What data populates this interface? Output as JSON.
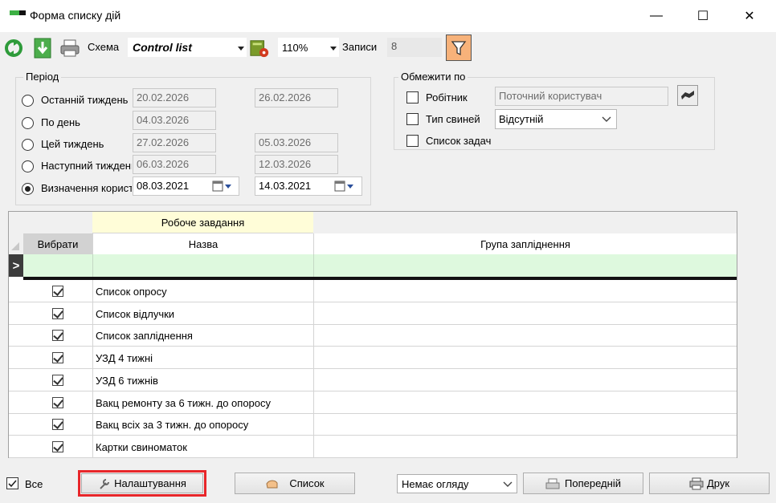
{
  "window": {
    "title": "Форма списку дій",
    "minimize_glyph": "—",
    "maximize_glyph": "☐",
    "close_glyph": "✕"
  },
  "toolbar": {
    "scheme_label": "Схема",
    "scheme_value": "Control list",
    "zoom_value": "110%",
    "records_label": "Записи",
    "records_value": "8",
    "icons": [
      "refresh-icon",
      "download-icon",
      "print-icon",
      "scheme-settings-icon",
      "filter-icon"
    ]
  },
  "period": {
    "title": "Період",
    "options": [
      {
        "label": "Останній тиждень",
        "from": "20.02.2026",
        "to": "26.02.2026",
        "selected": false
      },
      {
        "label": "По день",
        "from": "04.03.2026",
        "to": "",
        "selected": false
      },
      {
        "label": "Цей тиждень",
        "from": "27.02.2026",
        "to": "05.03.2026",
        "selected": false
      },
      {
        "label": "Наступний тиждень",
        "from": "06.03.2026",
        "to": "12.03.2026",
        "selected": false
      },
      {
        "label": "Визначення користувача",
        "from": "08.03.2021",
        "to": "14.03.2021",
        "selected": true
      }
    ]
  },
  "limit": {
    "title": "Обмежити по",
    "worker_label": "Робітник",
    "worker_value": "Поточний користувач",
    "pig_type_label": "Тип свиней",
    "pig_type_value": "Відсутній",
    "task_list_label": "Список задач"
  },
  "grid": {
    "group_header": "Робоче завдання",
    "columns": {
      "select": "Вибрати",
      "name": "Назва",
      "group": "Група запліднення"
    },
    "new_row_marker": ">",
    "rows": [
      {
        "checked": true,
        "name": "Список опросу",
        "group": ""
      },
      {
        "checked": true,
        "name": "Список відлучки",
        "group": ""
      },
      {
        "checked": true,
        "name": "Список запліднення",
        "group": ""
      },
      {
        "checked": true,
        "name": "УЗД 4 тижні",
        "group": ""
      },
      {
        "checked": true,
        "name": "УЗД 6 тижнів",
        "group": ""
      },
      {
        "checked": true,
        "name": "Вакц ремонту за 6 тижн. до опоросу",
        "group": ""
      },
      {
        "checked": true,
        "name": "Вакц всіх за 3 тижн. до опоросу",
        "group": ""
      },
      {
        "checked": true,
        "name": "Картки свиноматок",
        "group": ""
      }
    ]
  },
  "bottom": {
    "all_label": "Все",
    "all_checked": true,
    "settings_label": "Налаштування",
    "list_label": "Список",
    "preview_value": "Немає огляду",
    "previous_label": "Попередній",
    "print_label": "Друк",
    "highlight_color": "#e8262a"
  }
}
